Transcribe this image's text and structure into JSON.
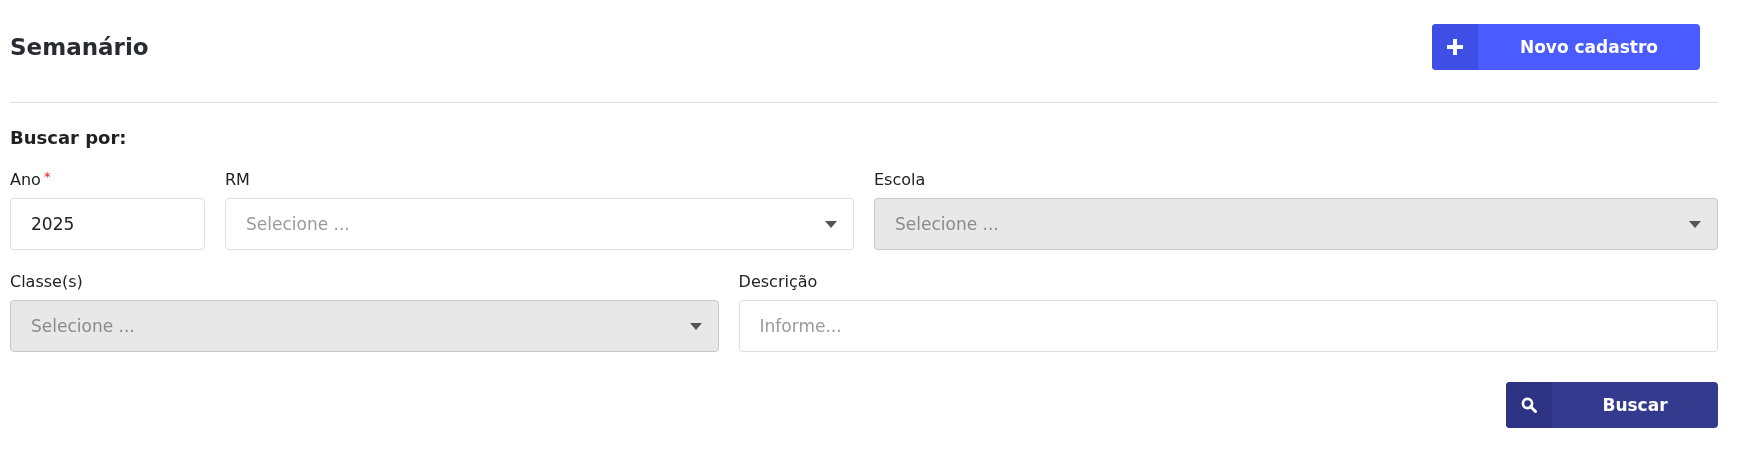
{
  "page": {
    "title": "Semanário"
  },
  "new_button": {
    "label": "Novo cadastro"
  },
  "search": {
    "heading": "Buscar por:",
    "rows": [
      [
        {
          "kind": "text",
          "label": "Ano",
          "required_mark": "*",
          "value": "2025",
          "disabled": false
        },
        {
          "kind": "select",
          "label": "RM",
          "placeholder": "Selecione ...",
          "disabled": false
        },
        {
          "kind": "select",
          "label": "Escola",
          "placeholder": "Selecione ...",
          "disabled": true
        }
      ],
      [
        {
          "kind": "select",
          "label": "Classe(s)",
          "placeholder": "Selecione ...",
          "disabled": true
        },
        {
          "kind": "text",
          "label": "Descrição",
          "placeholder": "Informe...",
          "disabled": false
        }
      ]
    ]
  },
  "submit_button": {
    "label": "Buscar"
  }
}
